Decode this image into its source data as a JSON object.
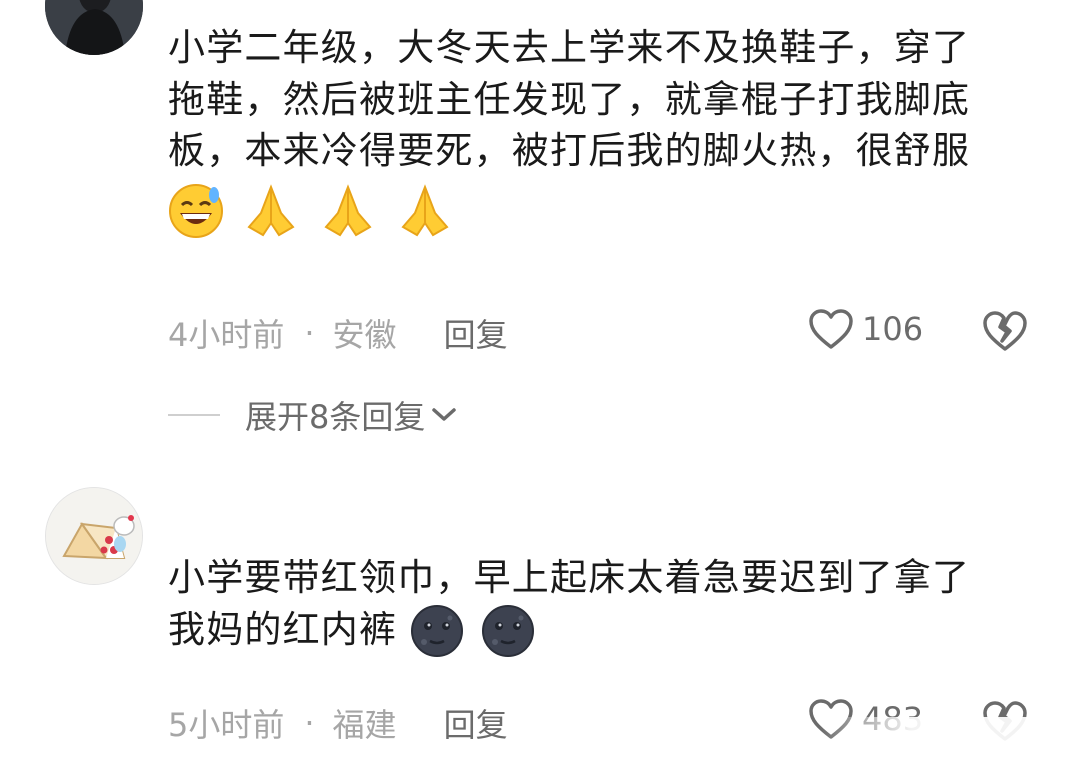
{
  "comments": [
    {
      "text_lines": [
        "小学二年级，大冬天去上学来不及换鞋子，穿了",
        "拖鞋，然后被班主任发现了，就拿棍子打我脚底",
        "板，本来冷得要死，被打后我的脚火热，很舒服"
      ],
      "emojis": [
        "grinning-sweat-emoji",
        "praying-hands-emoji",
        "praying-hands-emoji",
        "praying-hands-emoji"
      ],
      "time": "4小时前",
      "separator": "·",
      "location": "安徽",
      "reply_label": "回复",
      "likes": "106"
    },
    {
      "text_lines": [
        "小学要带红领巾，早上起床太着急要迟到了拿了",
        "我妈的红内裤"
      ],
      "emojis": [
        "new-moon-face-emoji",
        "new-moon-face-emoji"
      ],
      "time": "5小时前",
      "separator": "·",
      "location": "福建",
      "reply_label": "回复",
      "likes": "483"
    }
  ],
  "expand_replies": {
    "label": "展开8条回复"
  },
  "colors": {
    "text": "#1a1a1a",
    "meta": "#a6a6a6",
    "action": "#6b6b6b",
    "background": "#ffffff"
  }
}
